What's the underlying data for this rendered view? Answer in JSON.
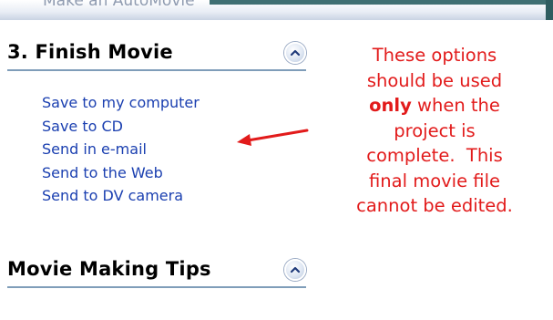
{
  "top_partial_link": "Make an AutoMovie",
  "finish_section": {
    "title": "3. Finish Movie",
    "collapse_icon": "chevron-up-icon",
    "items": [
      {
        "label": "Save to my computer"
      },
      {
        "label": "Save to CD"
      },
      {
        "label": "Send in e-mail"
      },
      {
        "label": "Send to the Web"
      },
      {
        "label": "Send to DV camera"
      }
    ]
  },
  "tips_section": {
    "title": "Movie Making Tips",
    "collapse_icon": "chevron-up-icon"
  },
  "note": {
    "line1": "These options",
    "line2": "should be used",
    "line3_bold": "only",
    "line3_rest": " when the",
    "line4": "project is",
    "line5": "complete.  This",
    "line6": "final movie file",
    "line7": "cannot be edited."
  },
  "colors": {
    "link": "#1a3fb0",
    "note": "#e21b1b",
    "arrow": "#e21b1b",
    "header_rule": "#7f9db9"
  }
}
